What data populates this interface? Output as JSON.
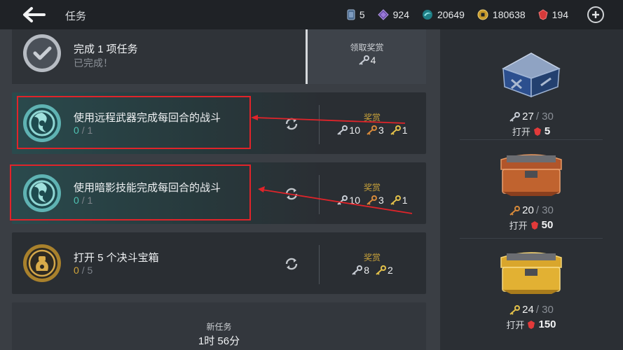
{
  "header": {
    "title": "任务",
    "currencies": [
      {
        "icon": "ticket-icon",
        "value": "5"
      },
      {
        "icon": "purple-crystal-icon",
        "value": "924"
      },
      {
        "icon": "teal-orb-icon",
        "value": "20649"
      },
      {
        "icon": "gold-coin-icon",
        "value": "180638"
      },
      {
        "icon": "ruby-icon",
        "value": "194"
      }
    ]
  },
  "quests": [
    {
      "name": "完成 1 项任务",
      "progress": "已完成！",
      "reward_label": "领取奖赏",
      "keys": [
        {
          "tier": "silver",
          "count": "4"
        }
      ]
    },
    {
      "name": "使用远程武器完成每回合的战斗",
      "progress_current": "0",
      "progress_total": "/ 1",
      "reward_label": "奖赏",
      "keys": [
        {
          "tier": "silver",
          "count": "10"
        },
        {
          "tier": "bronze",
          "count": "3"
        },
        {
          "tier": "gold",
          "count": "1"
        }
      ]
    },
    {
      "name": "使用暗影技能完成每回合的战斗",
      "progress_current": "0",
      "progress_total": "/ 1",
      "reward_label": "奖赏",
      "keys": [
        {
          "tier": "silver",
          "count": "10"
        },
        {
          "tier": "bronze",
          "count": "3"
        },
        {
          "tier": "gold",
          "count": "1"
        }
      ]
    },
    {
      "name": "打开 5 个决斗宝箱",
      "progress_current": "0",
      "progress_total": "/ 5",
      "reward_label": "奖赏",
      "keys": [
        {
          "tier": "silver",
          "count": "8"
        },
        {
          "tier": "bronze",
          "count": "2"
        }
      ]
    }
  ],
  "new_quest": {
    "label": "新任务",
    "time": "1时 56分"
  },
  "chests": [
    {
      "tier": "silver",
      "keys_have": "27",
      "keys_need": "/ 30",
      "open_label": "打开",
      "cost": "5"
    },
    {
      "tier": "bronze",
      "keys_have": "20",
      "keys_need": "/ 30",
      "open_label": "打开",
      "cost": "50"
    },
    {
      "tier": "gold",
      "keys_have": "24",
      "keys_need": "/ 30",
      "open_label": "打开",
      "cost": "150"
    }
  ],
  "colors": {
    "silver_key": "#c9ced6",
    "bronze_key": "#d88a3a",
    "gold_key": "#e3c14a",
    "ruby": "#e23a3a",
    "annotation_red": "#e0242a",
    "reward_label": "#c8a23a"
  }
}
